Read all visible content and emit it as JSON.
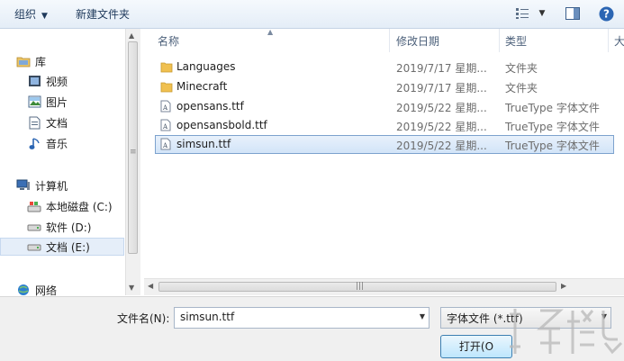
{
  "toolbar": {
    "organize": "组织",
    "new_folder": "新建文件夹"
  },
  "nav": {
    "library": "库",
    "videos": "视频",
    "pictures": "图片",
    "documents": "文档",
    "music": "音乐",
    "computer": "计算机",
    "drive_c": "本地磁盘 (C:)",
    "drive_d": "软件 (D:)",
    "drive_e": "文档 (E:)",
    "network": "网络"
  },
  "columns": {
    "name": "名称",
    "date": "修改日期",
    "type": "类型",
    "size": "大"
  },
  "files": [
    {
      "name": "Languages",
      "date": "2019/7/17 星期...",
      "type": "文件夹",
      "icon": "folder-icon"
    },
    {
      "name": "Minecraft",
      "date": "2019/7/17 星期...",
      "type": "文件夹",
      "icon": "folder-icon"
    },
    {
      "name": "opensans.ttf",
      "date": "2019/5/22 星期...",
      "type": "TrueType 字体文件",
      "icon": "font-file-icon"
    },
    {
      "name": "opensansbold.ttf",
      "date": "2019/5/22 星期...",
      "type": "TrueType 字体文件",
      "icon": "font-file-icon"
    },
    {
      "name": "simsun.ttf",
      "date": "2019/5/22 星期...",
      "type": "TrueType 字体文件",
      "icon": "font-file-icon",
      "selected": true
    }
  ],
  "bottom": {
    "filename_label": "文件名(N):",
    "filename_value": "simsun.ttf",
    "filetype_value": "字体文件 (*.ttf)",
    "open_label": "打开(O"
  },
  "colors": {
    "selection": "#d2e4f8",
    "selection_border": "#7da2ce",
    "folder": "#f0c050",
    "accent": "#2a5a9a"
  }
}
